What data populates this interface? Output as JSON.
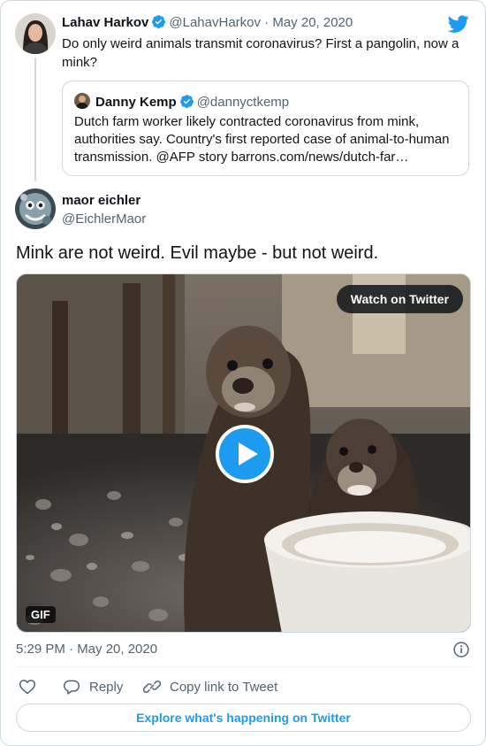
{
  "colors": {
    "brand": "#1d9bf0",
    "text": "#0f1419",
    "muted": "#536471",
    "border": "#cfd9de"
  },
  "parent_tweet": {
    "name": "Lahav Harkov",
    "handle": "@LahavHarkov",
    "separator": "·",
    "date": "May 20, 2020",
    "text": "Do only weird animals transmit coronavirus? First a pangolin, now a mink?",
    "verified_icon": "verified-badge-icon"
  },
  "quoted_tweet": {
    "name": "Danny Kemp",
    "handle": "@dannyctkemp",
    "text": "Dutch farm worker likely contracted coronavirus from mink, authorities say. Country's first reported case of animal-to-human transmission. @AFP story barrons.com/news/dutch-far…"
  },
  "tweet": {
    "name": "maor eichler",
    "handle": "@EichlerMaor",
    "text": "Mink are not weird. Evil maybe - but not weird.",
    "media": {
      "watch_label": "Watch on Twitter",
      "gif_badge": "GIF",
      "play_icon": "play-icon"
    },
    "timestamp": "5:29 PM · May 20, 2020"
  },
  "actions": {
    "like_icon": "heart-icon",
    "reply_label": "Reply",
    "copy_label": "Copy link to Tweet"
  },
  "footer": {
    "explore_label": "Explore what's happening on Twitter"
  }
}
